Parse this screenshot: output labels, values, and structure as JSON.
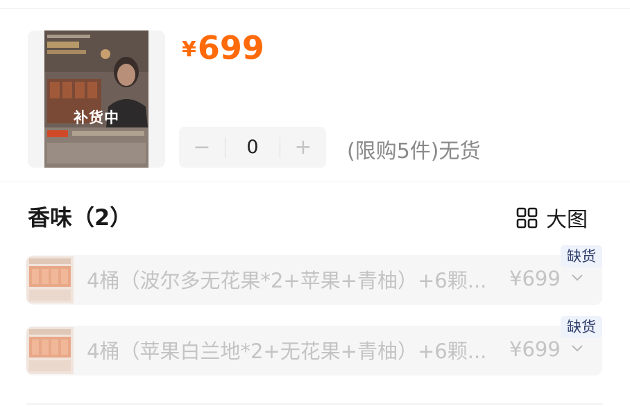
{
  "product": {
    "thumb_label": "补货中",
    "price_symbol": "¥",
    "price_value": "699",
    "quantity": {
      "minus": "−",
      "value": "0",
      "plus": "+"
    },
    "stock_note": "(限购5件)无货"
  },
  "section": {
    "title": "香味（2）",
    "view_toggle_label": "大图",
    "view_toggle_icon": "grid-icon"
  },
  "options": [
    {
      "name": "4桶（波尔多无花果*2+苹果+青柚）+6颗...",
      "price": "¥699",
      "badge": "缺货"
    },
    {
      "name": "4桶（苹果白兰地*2+无花果+青柚）+6颗...",
      "price": "¥699",
      "badge": "缺货"
    }
  ],
  "colors": {
    "price": "#ff6a0a",
    "badge_bg": "#eef2fb",
    "badge_text": "#2e3d6a",
    "disabled_text": "#c4c4c4"
  }
}
